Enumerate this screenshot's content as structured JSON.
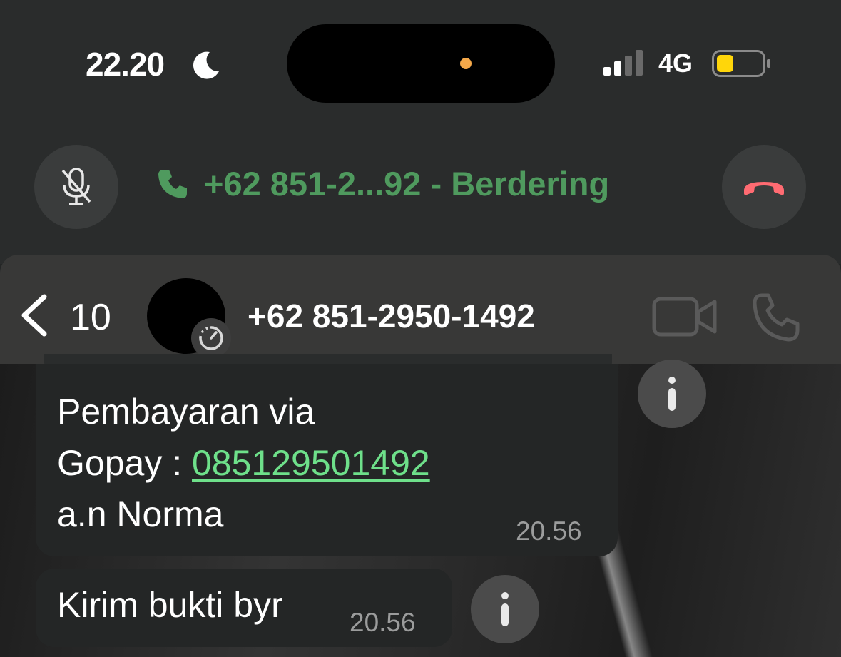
{
  "status_bar": {
    "time": "22.20",
    "focus_icon": "moon-icon",
    "signal_icon": "cellular-signal-icon",
    "network": "4G",
    "battery_icon": "battery-low-icon",
    "battery_color": "#ffd60a",
    "privacy_dot_color": "#f5a94a"
  },
  "call_banner": {
    "status": "+62 851-2...92 - Berdering",
    "status_color": "#4f9a5e",
    "mute_icon": "mic-muted-icon",
    "end_icon": "end-call-icon",
    "end_color": "#ff6b72"
  },
  "chat_header": {
    "back_count": "10",
    "contact_name": "+62 851-2950-1492",
    "avatar_badge_icon": "disappearing-timer-icon",
    "video_icon": "video-call-icon",
    "voice_icon": "voice-call-icon"
  },
  "messages": [
    {
      "line1": "Pembayaran via",
      "line2_prefix": "Gopay : ",
      "line2_link": "085129501492",
      "line3": "a.n Norma",
      "time": "20.56"
    },
    {
      "text": "Kirim bukti byr",
      "time": "20.56"
    }
  ]
}
